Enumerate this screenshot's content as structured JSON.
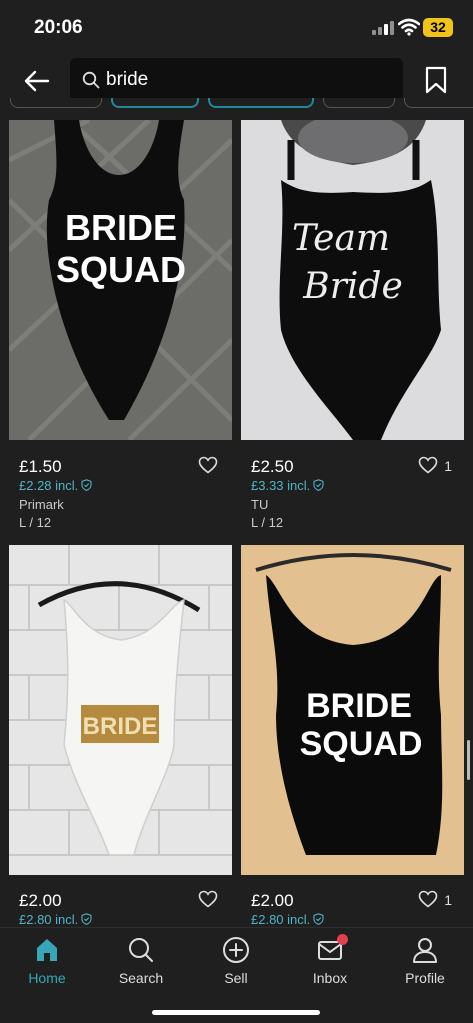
{
  "status": {
    "time": "20:06",
    "battery": "32"
  },
  "search": {
    "query": "bride"
  },
  "listings": [
    {
      "price": "£1.50",
      "price_incl": "£2.28 incl.",
      "brand": "Primark",
      "size": "L / 12",
      "favourites": "",
      "print": [
        "BRIDE",
        "SQUAD"
      ]
    },
    {
      "price": "£2.50",
      "price_incl": "£3.33 incl.",
      "brand": "TU",
      "size": "L / 12",
      "favourites": "1",
      "print": [
        "Team",
        "Bride"
      ]
    },
    {
      "price": "£2.00",
      "price_incl": "£2.80 incl.",
      "brand": "",
      "size": "",
      "favourites": "",
      "print": [
        "BRIDE"
      ]
    },
    {
      "price": "£2.00",
      "price_incl": "£2.80 incl.",
      "brand": "",
      "size": "",
      "favourites": "1",
      "print": [
        "BRIDE",
        "SQUAD"
      ]
    }
  ],
  "tabs": [
    {
      "label": "Home",
      "icon": "home-icon",
      "active": true
    },
    {
      "label": "Search",
      "icon": "search-icon"
    },
    {
      "label": "Sell",
      "icon": "plus-circle-icon"
    },
    {
      "label": "Inbox",
      "icon": "mail-icon",
      "badge": true
    },
    {
      "label": "Profile",
      "icon": "person-icon"
    }
  ],
  "colors": {
    "accent": "#36a6b8",
    "background": "#1f1f1f",
    "badge": "#e04151"
  }
}
